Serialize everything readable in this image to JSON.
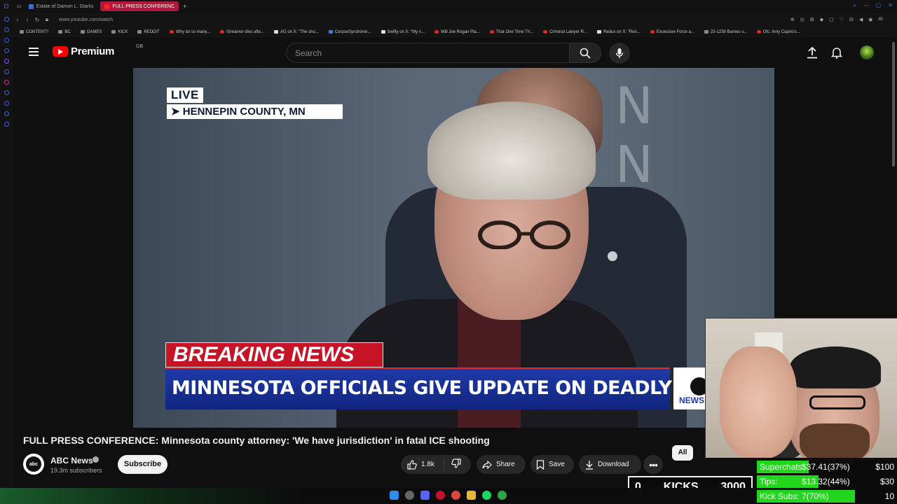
{
  "browser": {
    "tabs": [
      {
        "label": "Estate of Damon L. Starks",
        "active": false
      },
      {
        "label": "FULL PRESS CONFERENC",
        "active": true
      }
    ],
    "url": "www.youtube.com/watch",
    "bookmarks": [
      "CONTENT?",
      "BC",
      "GAMES",
      "KICK",
      "REDDIT",
      "Why do so many...",
      "Streamer dies afte...",
      "AG on X: \"The sho...",
      "CorpseSyndrome...",
      "Swifty on X: \"My n...",
      "Will Joe Rogan Pla...",
      "That One Time Th...",
      "Criminal Lawyer R...",
      "Redux on X: \"Ren...",
      "Excessive Force a...",
      "23-1239 Barnes v...",
      "Ofc. Amy Caprio's..."
    ]
  },
  "youtube": {
    "logo_text": "Premium",
    "region": "GB",
    "search_placeholder": "Search"
  },
  "video": {
    "live_label": "LIVE",
    "location": "HENNEPIN COUNTY, MN",
    "breaking_label": "BREAKING NEWS",
    "headline": "MINNESOTA OFFICIALS GIVE UPDATE ON DEADLY ICE SHOOTING",
    "network_tag": "NEWS",
    "wall_text": "N N"
  },
  "info": {
    "title": "FULL PRESS CONFERENCE: Minnesota county attorney: 'We have jurisdiction' in fatal ICE shooting",
    "channel": "ABC News",
    "channel_avatar_text": "abc NEWS",
    "subscribers": "19.3m subscribers",
    "subscribe_label": "Subscribe",
    "likes": "1.8k",
    "share_label": "Share",
    "save_label": "Save",
    "download_label": "Download",
    "chip_all": "All"
  },
  "overlay": {
    "kicks_count": "0",
    "kicks_label": "KICKS",
    "kicks_goal": "3000",
    "stats": [
      {
        "label": "Superchats:",
        "value": "$37.41(37%)",
        "goal": "$100",
        "progress": 0.37
      },
      {
        "label": "Tips:",
        "value": "$13.32(44%)",
        "goal": "$30",
        "progress": 0.44
      },
      {
        "label": "Kick Subs:",
        "value": "7(70%)",
        "goal": "10",
        "progress": 0.7
      }
    ]
  },
  "colors": {
    "brand_red": "#ff0000",
    "breaking_red": "#c41426",
    "headline_blue": "#1f3aa8",
    "progress_green": "#22d61e"
  }
}
